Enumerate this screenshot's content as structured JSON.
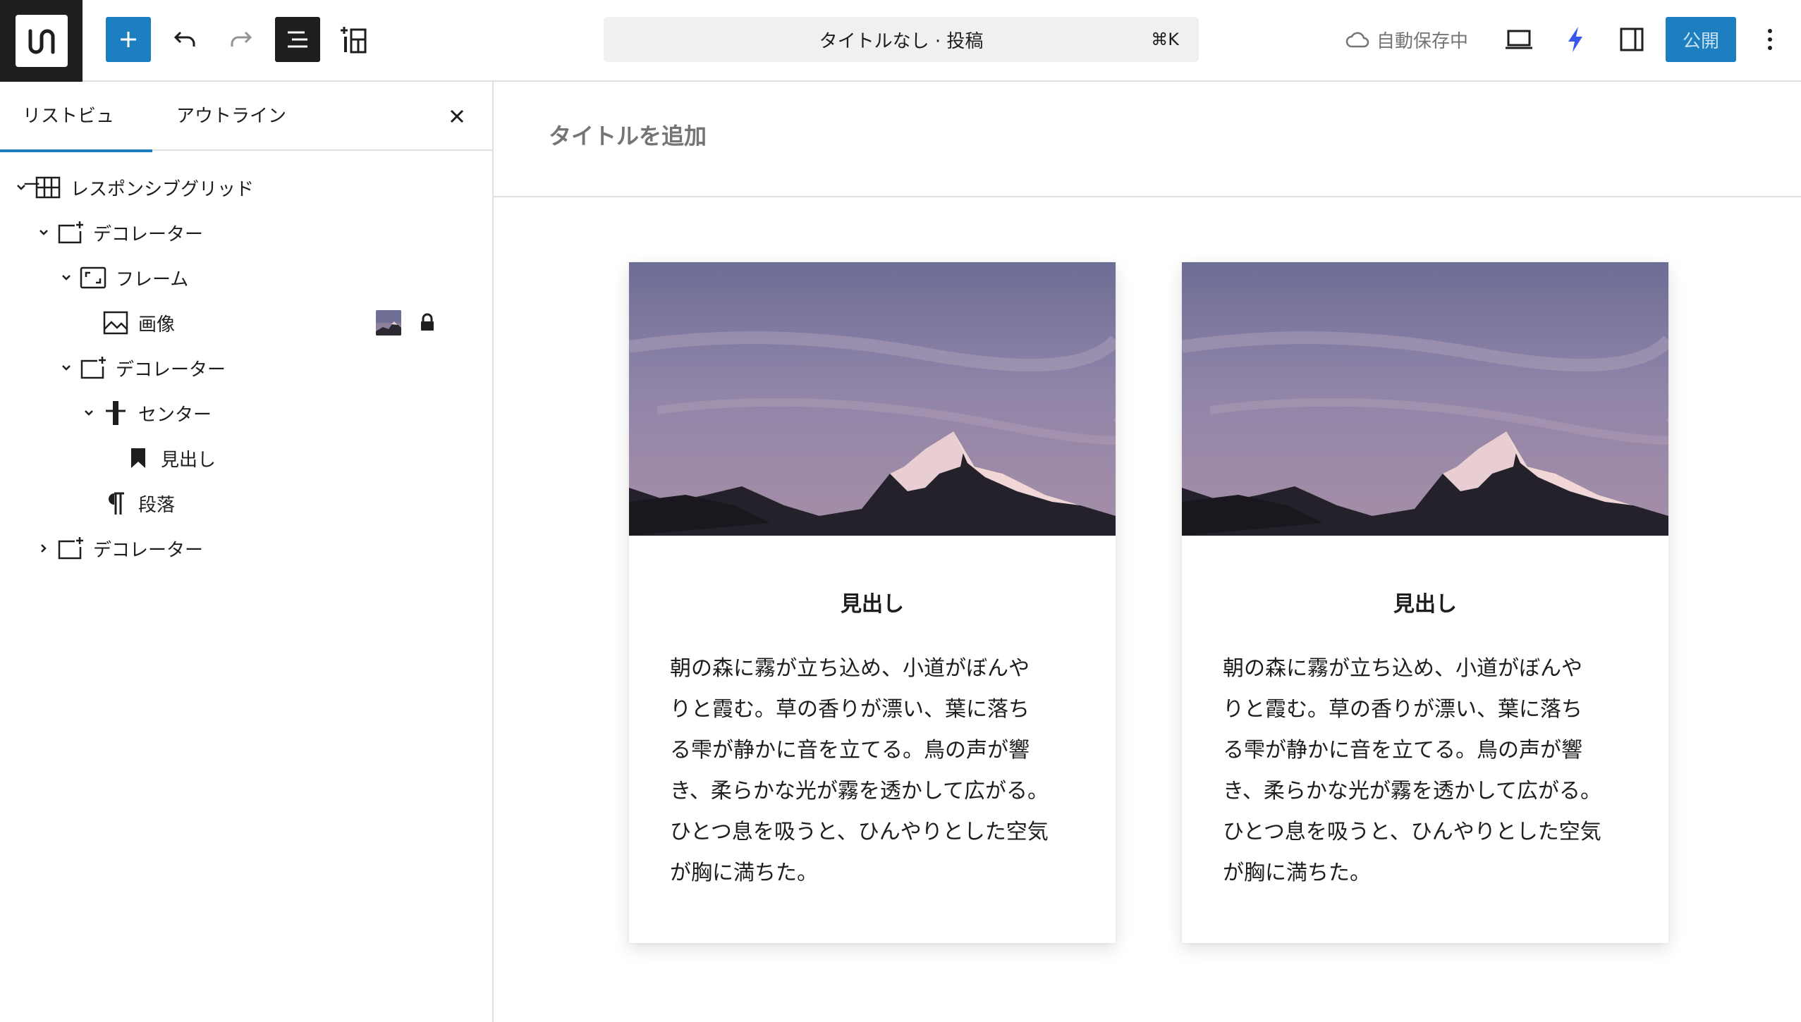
{
  "toolbar": {
    "document_title": "タイトルなし · 投稿",
    "shortcut": "⌘K",
    "autosave_label": "自動保存中",
    "publish_label": "公開"
  },
  "sidebar": {
    "tabs": [
      {
        "label": "リストビュー",
        "active": true
      },
      {
        "label": "アウトライン",
        "active": false
      }
    ],
    "tree": [
      {
        "label": "レスポンシブグリッド",
        "level": 0,
        "chevron": "down",
        "icon": "grid-icon"
      },
      {
        "label": "デコレーター",
        "level": 1,
        "chevron": "down",
        "icon": "decorator-icon"
      },
      {
        "label": "フレーム",
        "level": 2,
        "chevron": "down",
        "icon": "frame-icon"
      },
      {
        "label": "画像",
        "level": 3,
        "chevron": "none",
        "icon": "image-icon",
        "locked": true
      },
      {
        "label": "デコレーター",
        "level": 2,
        "chevron": "down",
        "icon": "decorator-icon"
      },
      {
        "label": "センター",
        "level": 3,
        "chevron": "down",
        "icon": "center-icon"
      },
      {
        "label": "見出し",
        "level": 4,
        "chevron": "none",
        "icon": "bookmark-icon"
      },
      {
        "label": "段落",
        "level": 3,
        "chevron": "none",
        "icon": "paragraph-icon"
      },
      {
        "label": "デコレーター",
        "level": 1,
        "chevron": "right",
        "icon": "decorator-icon"
      }
    ]
  },
  "editor": {
    "title_placeholder": "タイトルを追加",
    "cards": [
      {
        "heading": "見出し",
        "body_lines": [
          "朝の森に霧が立ち込め、小道がぼんや",
          "りと霞む。草の香りが漂い、葉に落ち",
          "る雫が静かに音を立てる。鳥の声が響",
          "き、柔らかな光が霧を透かして広がる。",
          "ひとつ息を吸うと、ひんやりとした空気",
          "が胸に満ちた。"
        ]
      },
      {
        "heading": "見出し",
        "body_lines": [
          "朝の森に霧が立ち込め、小道がぼんや",
          "りと霞む。草の香りが漂い、葉に落ち",
          "る雫が静かに音を立てる。鳥の声が響",
          "き、柔らかな光が霧を透かして広がる。",
          "ひとつ息を吸うと、ひんやりとした空気",
          "が胸に満ちた。"
        ]
      }
    ]
  },
  "colors": {
    "accent": "#1d7fbf",
    "dark": "#1e1e1e",
    "muted": "#757575",
    "border": "#e0e0e0"
  }
}
